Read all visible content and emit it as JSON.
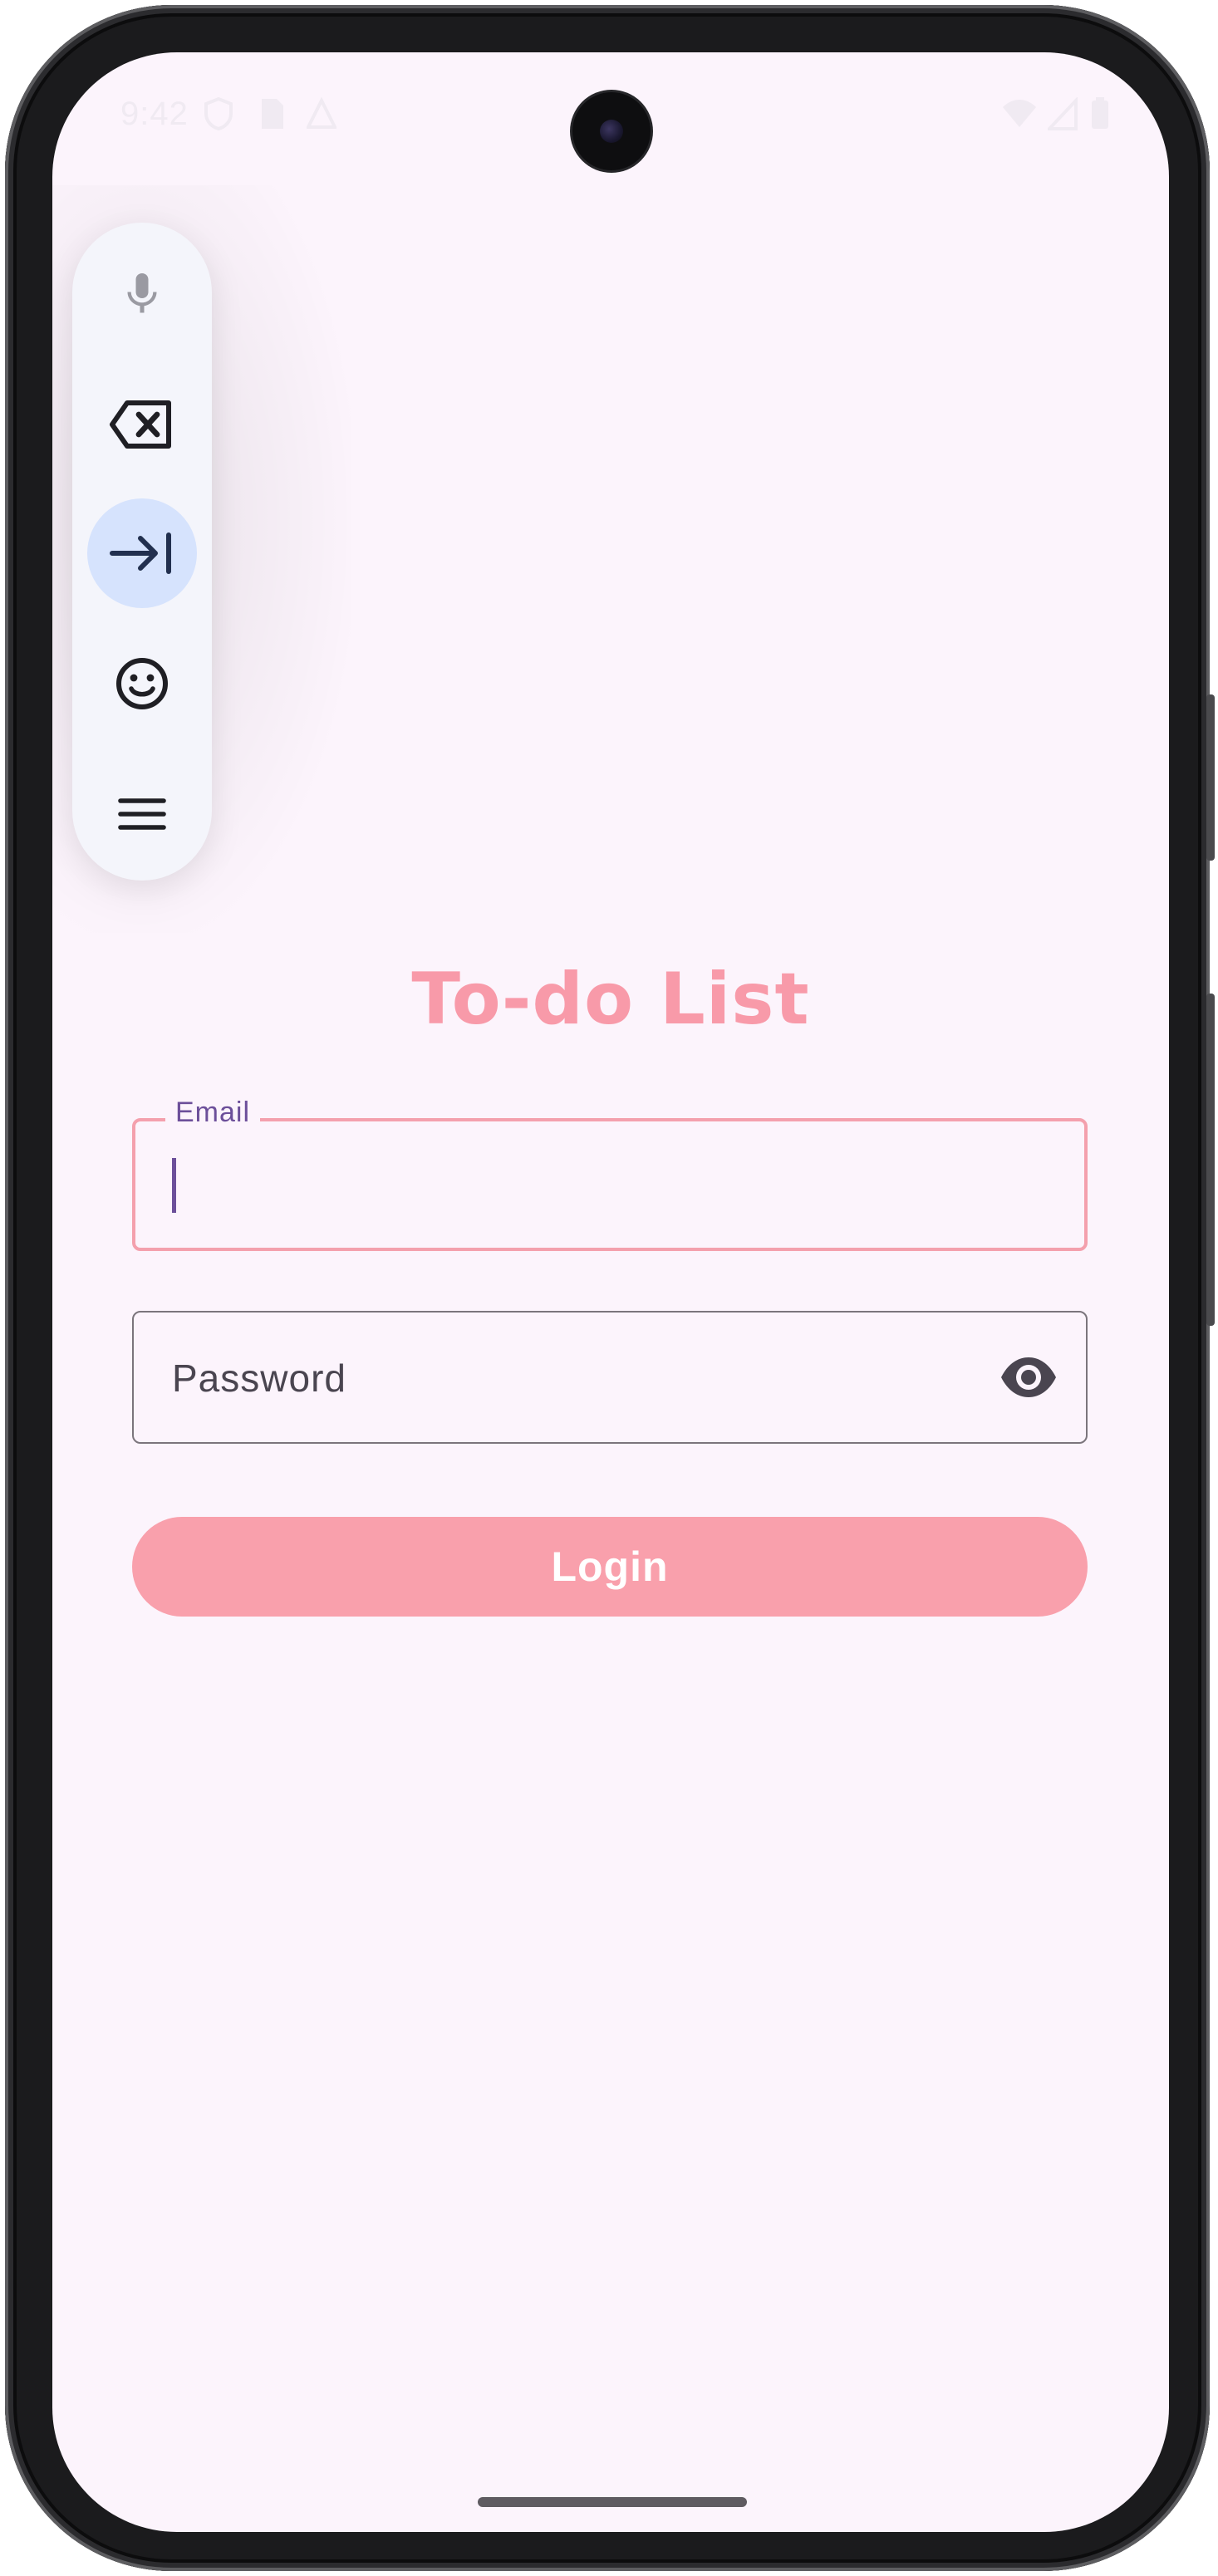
{
  "status_bar": {
    "time": "9:42",
    "icons": [
      "shield-icon",
      "sim-icon",
      "alert-triangle-icon",
      "wifi-icon",
      "signal-icon",
      "battery-icon"
    ]
  },
  "keyboard_toolbar": {
    "items": [
      {
        "icon": "microphone-icon",
        "active": false
      },
      {
        "icon": "backspace-icon",
        "active": false
      },
      {
        "icon": "tab-icon",
        "active": true
      },
      {
        "icon": "emoji-icon",
        "active": false
      },
      {
        "icon": "menu-icon",
        "active": false
      }
    ]
  },
  "app": {
    "title": "To-do List",
    "email_field": {
      "label": "Email",
      "value": ""
    },
    "password_field": {
      "placeholder": "Password",
      "toggle_icon": "eye-icon"
    },
    "login_button": {
      "label": "Login"
    }
  },
  "colors": {
    "accent": "#f89aa9",
    "background": "#fcf4fc",
    "label": "#6c4f9a",
    "button": "#f9a0ac"
  }
}
